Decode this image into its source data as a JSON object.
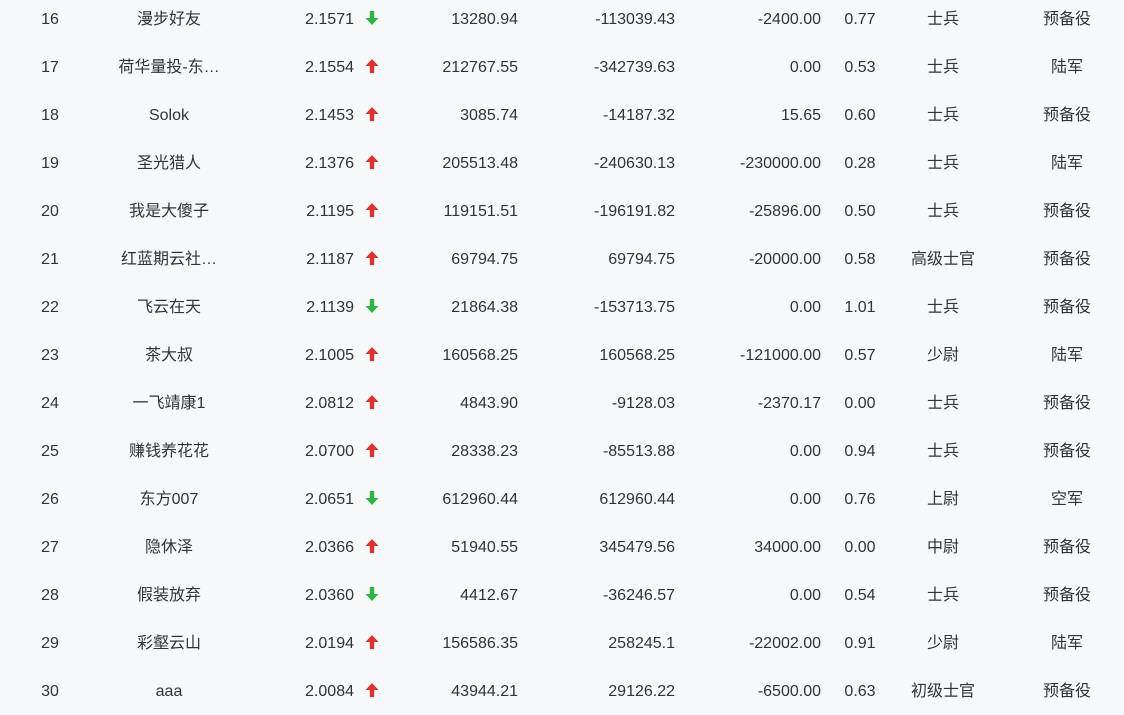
{
  "colors": {
    "up": "#e03131",
    "down": "#2fb344",
    "text": "#333333",
    "background": "#f7f8fa"
  },
  "rows": [
    {
      "rank": "16",
      "name": "漫步好友",
      "ratio": "2.1571",
      "trend": "down",
      "v1": "13280.94",
      "v2": "-113039.43",
      "v3": "-2400.00",
      "v4": "0.77",
      "title": "士兵",
      "branch": "预备役"
    },
    {
      "rank": "17",
      "name": "荷华量投-东…",
      "ratio": "2.1554",
      "trend": "up",
      "v1": "212767.55",
      "v2": "-342739.63",
      "v3": "0.00",
      "v4": "0.53",
      "title": "士兵",
      "branch": "陆军"
    },
    {
      "rank": "18",
      "name": "Solok",
      "ratio": "2.1453",
      "trend": "up",
      "v1": "3085.74",
      "v2": "-14187.32",
      "v3": "15.65",
      "v4": "0.60",
      "title": "士兵",
      "branch": "预备役"
    },
    {
      "rank": "19",
      "name": "圣光猎人",
      "ratio": "2.1376",
      "trend": "up",
      "v1": "205513.48",
      "v2": "-240630.13",
      "v3": "-230000.00",
      "v4": "0.28",
      "title": "士兵",
      "branch": "陆军"
    },
    {
      "rank": "20",
      "name": "我是大傻子",
      "ratio": "2.1195",
      "trend": "up",
      "v1": "119151.51",
      "v2": "-196191.82",
      "v3": "-25896.00",
      "v4": "0.50",
      "title": "士兵",
      "branch": "预备役"
    },
    {
      "rank": "21",
      "name": "红蓝期云社…",
      "ratio": "2.1187",
      "trend": "up",
      "v1": "69794.75",
      "v2": "69794.75",
      "v3": "-20000.00",
      "v4": "0.58",
      "title": "高级士官",
      "branch": "预备役"
    },
    {
      "rank": "22",
      "name": "飞云在天",
      "ratio": "2.1139",
      "trend": "down",
      "v1": "21864.38",
      "v2": "-153713.75",
      "v3": "0.00",
      "v4": "1.01",
      "title": "士兵",
      "branch": "预备役"
    },
    {
      "rank": "23",
      "name": "茶大叔",
      "ratio": "2.1005",
      "trend": "up",
      "v1": "160568.25",
      "v2": "160568.25",
      "v3": "-121000.00",
      "v4": "0.57",
      "title": "少尉",
      "branch": "陆军"
    },
    {
      "rank": "24",
      "name": "一飞靖康1",
      "ratio": "2.0812",
      "trend": "up",
      "v1": "4843.90",
      "v2": "-9128.03",
      "v3": "-2370.17",
      "v4": "0.00",
      "title": "士兵",
      "branch": "预备役"
    },
    {
      "rank": "25",
      "name": "赚钱养花花",
      "ratio": "2.0700",
      "trend": "up",
      "v1": "28338.23",
      "v2": "-85513.88",
      "v3": "0.00",
      "v4": "0.94",
      "title": "士兵",
      "branch": "预备役"
    },
    {
      "rank": "26",
      "name": "东方007",
      "ratio": "2.0651",
      "trend": "down",
      "v1": "612960.44",
      "v2": "612960.44",
      "v3": "0.00",
      "v4": "0.76",
      "title": "上尉",
      "branch": "空军"
    },
    {
      "rank": "27",
      "name": "隐休泽",
      "ratio": "2.0366",
      "trend": "up",
      "v1": "51940.55",
      "v2": "345479.56",
      "v3": "34000.00",
      "v4": "0.00",
      "title": "中尉",
      "branch": "预备役"
    },
    {
      "rank": "28",
      "name": "假装放弃",
      "ratio": "2.0360",
      "trend": "down",
      "v1": "4412.67",
      "v2": "-36246.57",
      "v3": "0.00",
      "v4": "0.54",
      "title": "士兵",
      "branch": "预备役"
    },
    {
      "rank": "29",
      "name": "彩壑云山",
      "ratio": "2.0194",
      "trend": "up",
      "v1": "156586.35",
      "v2": "258245.1",
      "v3": "-22002.00",
      "v4": "0.91",
      "title": "少尉",
      "branch": "陆军"
    },
    {
      "rank": "30",
      "name": "aaa",
      "ratio": "2.0084",
      "trend": "up",
      "v1": "43944.21",
      "v2": "29126.22",
      "v3": "-6500.00",
      "v4": "0.63",
      "title": "初级士官",
      "branch": "预备役"
    }
  ]
}
